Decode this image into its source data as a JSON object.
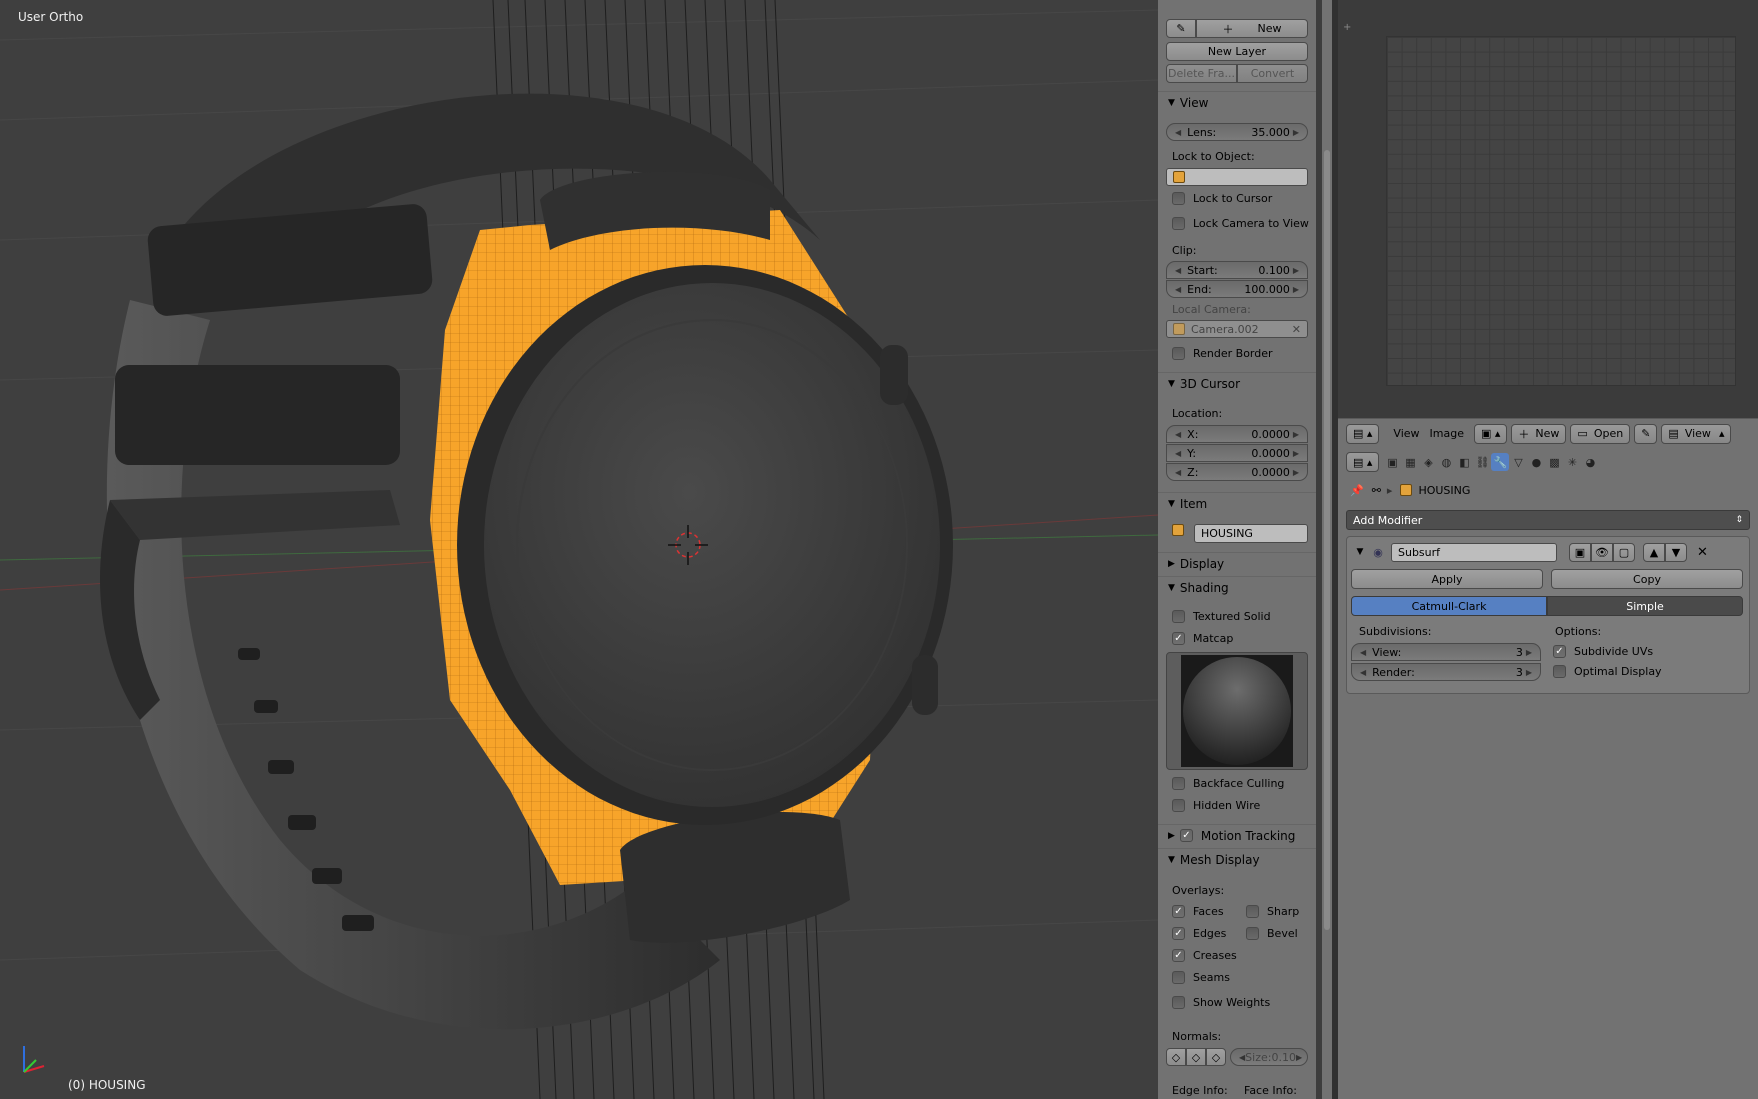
{
  "viewport": {
    "view_name": "User Ortho",
    "object_info": "(0) HOUSING",
    "selected_color": "#f7a42a"
  },
  "npanel": {
    "grease_pencil": {
      "new_label": "New",
      "new_layer_label": "New Layer",
      "delete_frame_label": "Delete Fra...",
      "convert_label": "Convert"
    },
    "view": {
      "header": "View",
      "lens_label": "Lens:",
      "lens_value": "35.000",
      "lock_to_object_label": "Lock to Object:",
      "lock_to_cursor_label": "Lock to Cursor",
      "lock_camera_label": "Lock Camera to View",
      "clip_label": "Clip:",
      "start_label": "Start:",
      "start_value": "0.100",
      "end_label": "End:",
      "end_value": "100.000",
      "local_camera_label": "Local Camera:",
      "local_camera_value": "Camera.002",
      "render_border_label": "Render Border"
    },
    "cursor": {
      "header": "3D Cursor",
      "location_label": "Location:",
      "x_label": "X:",
      "x_value": "0.0000",
      "y_label": "Y:",
      "y_value": "0.0000",
      "z_label": "Z:",
      "z_value": "0.0000"
    },
    "item": {
      "header": "Item",
      "name": "HOUSING"
    },
    "display": {
      "header": "Display"
    },
    "shading": {
      "header": "Shading",
      "textured_solid_label": "Textured Solid",
      "matcap_label": "Matcap",
      "backface_culling_label": "Backface Culling",
      "hidden_wire_label": "Hidden Wire"
    },
    "motion_tracking": {
      "header": "Motion Tracking"
    },
    "mesh_display": {
      "header": "Mesh Display",
      "overlays_label": "Overlays:",
      "faces_label": "Faces",
      "sharp_label": "Sharp",
      "edges_label": "Edges",
      "bevel_label": "Bevel",
      "creases_label": "Creases",
      "seams_label": "Seams",
      "show_weights_label": "Show Weights",
      "normals_label": "Normals:",
      "size_label": "Size:",
      "size_value": "0.10",
      "edge_info_label": "Edge Info:",
      "face_info_label": "Face Info:"
    }
  },
  "uv_header": {
    "view_label": "View",
    "image_label": "Image",
    "new_label": "New",
    "open_label": "Open",
    "view2_label": "View"
  },
  "properties": {
    "breadcrumb_object": "HOUSING",
    "add_modifier_label": "Add Modifier",
    "modifier_name": "Subsurf",
    "apply_label": "Apply",
    "copy_label": "Copy",
    "catmull_label": "Catmull-Clark",
    "simple_label": "Simple",
    "subdivisions_label": "Subdivisions:",
    "options_label": "Options:",
    "view_label": "View:",
    "view_value": "3",
    "render_label": "Render:",
    "render_value": "3",
    "subdivide_uvs_label": "Subdivide UVs",
    "optimal_display_label": "Optimal Display",
    "accent_color": "#5680c2"
  }
}
